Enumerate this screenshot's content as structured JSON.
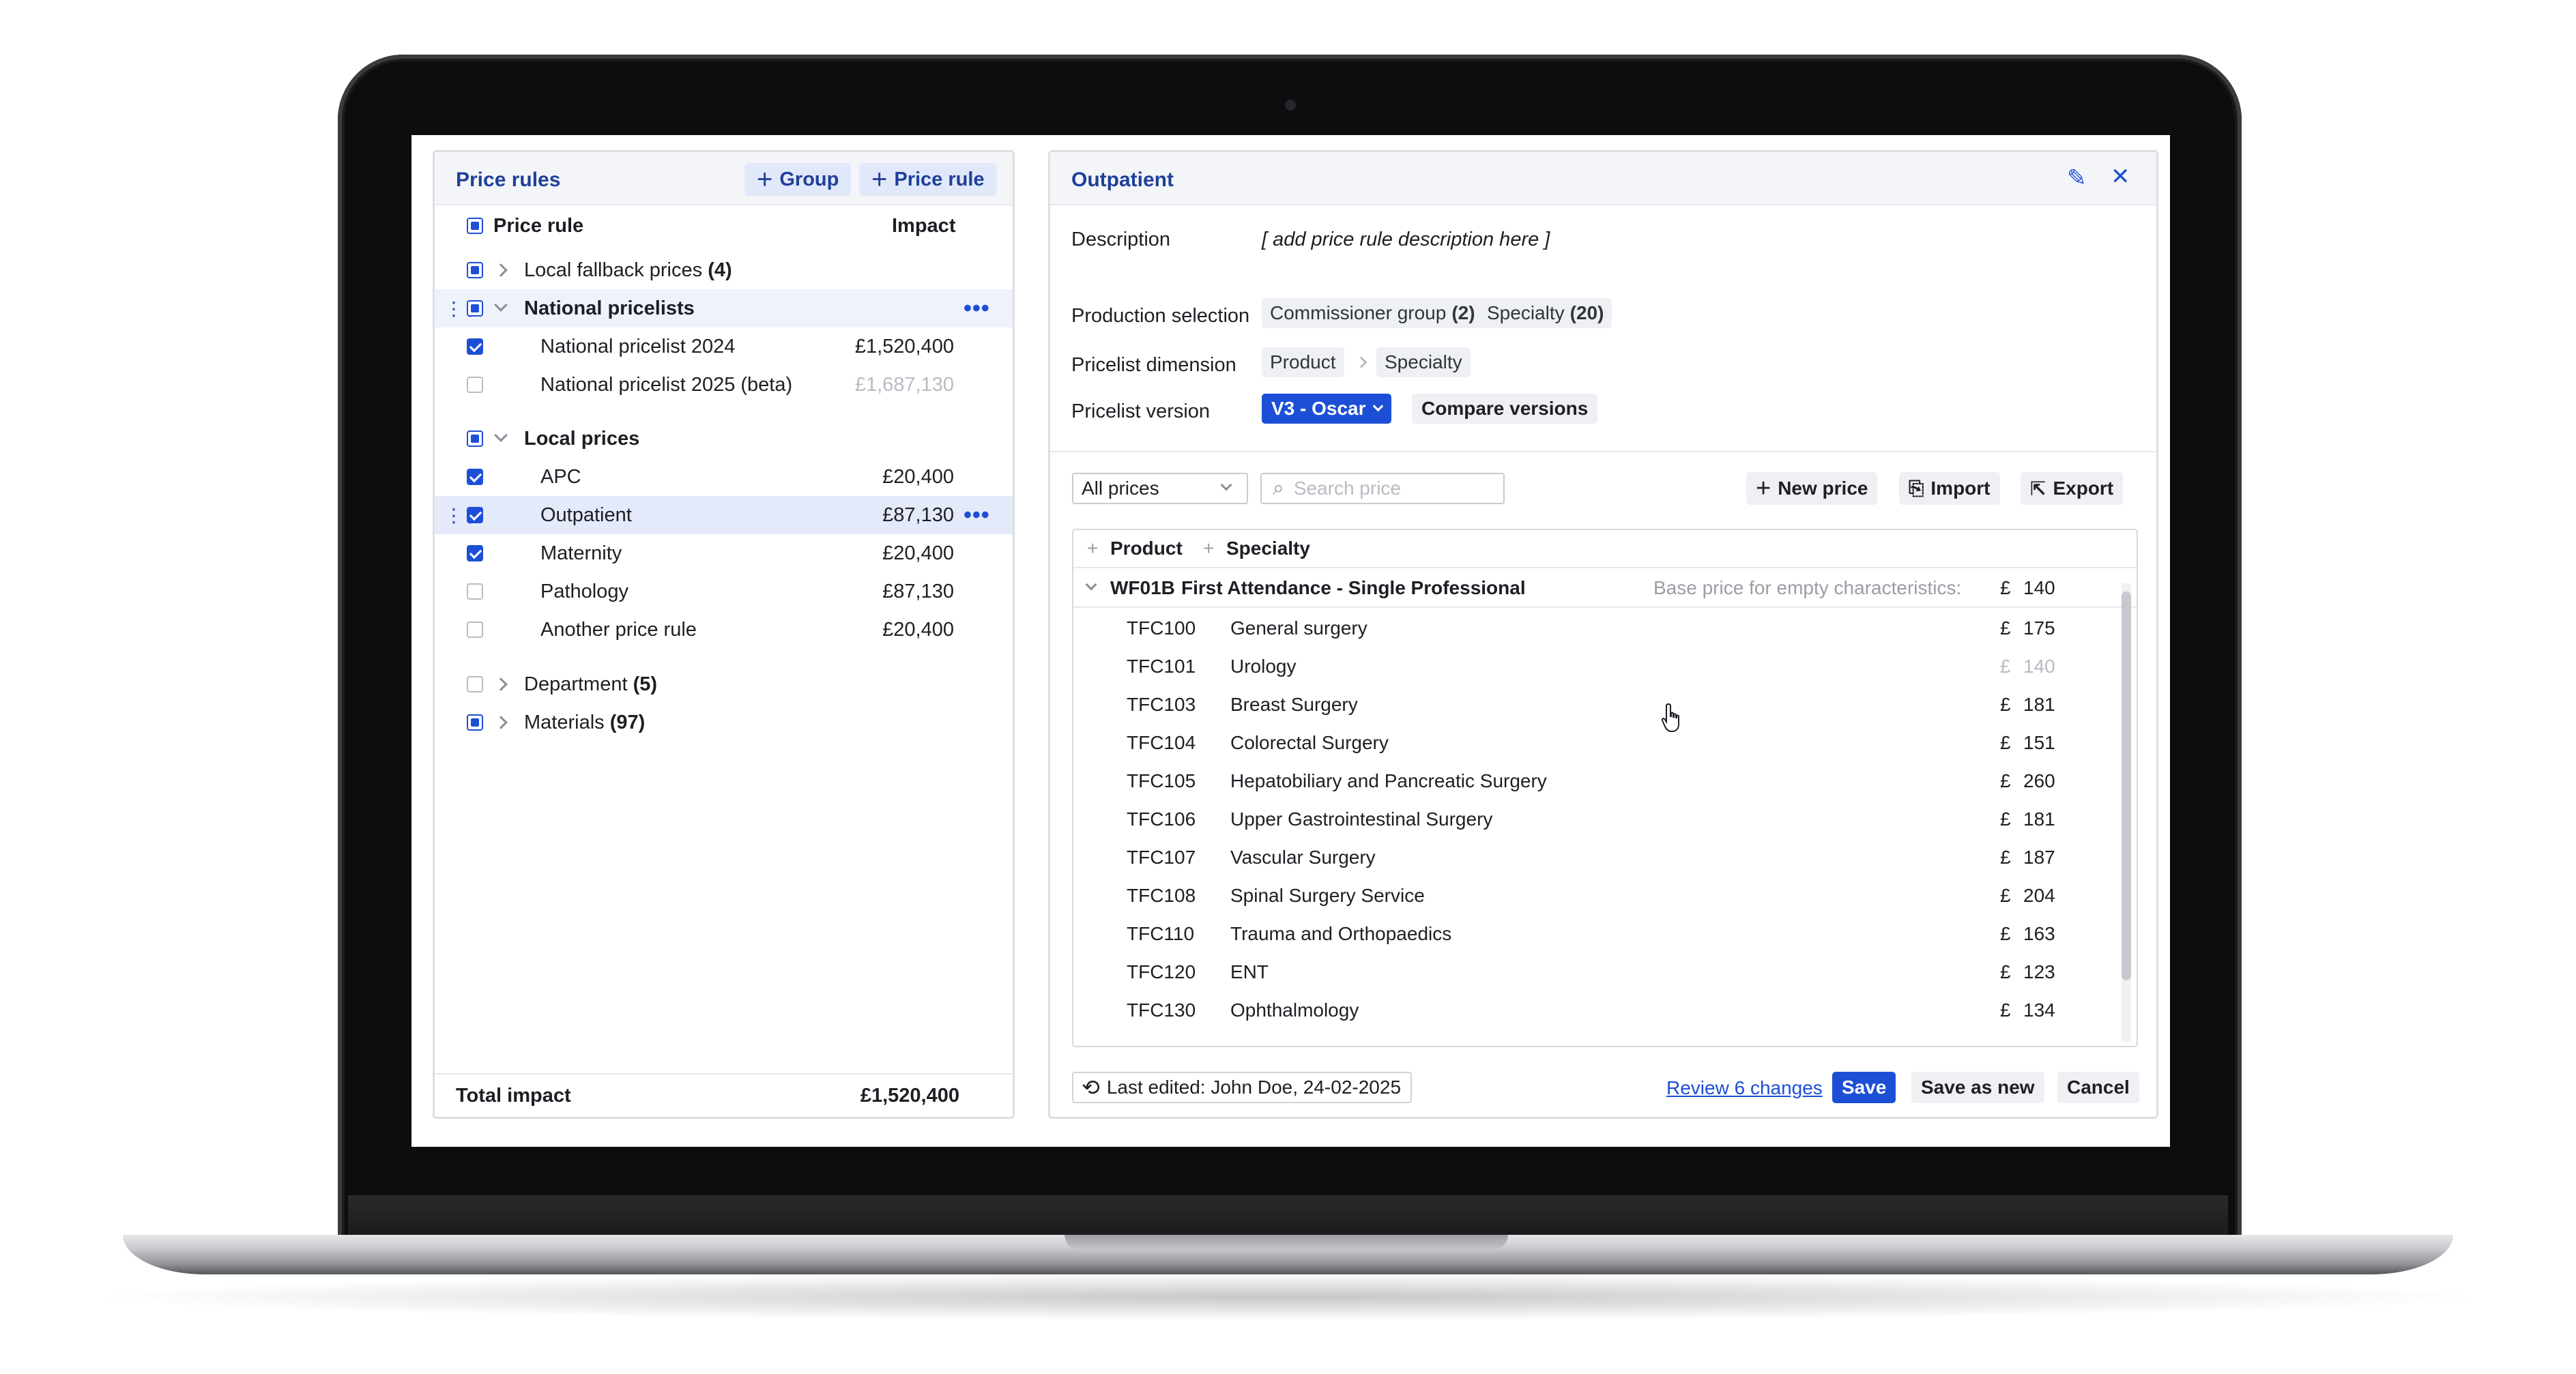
{
  "left": {
    "title": "Price rules",
    "add_group": "Group",
    "add_price_rule": "Price rule",
    "col_rule": "Price rule",
    "col_impact": "Impact",
    "groups": {
      "local_fallback": {
        "label": "Local fallback prices",
        "count": "(4)"
      },
      "national": {
        "label": "National pricelists"
      },
      "local": {
        "label": "Local prices"
      },
      "department": {
        "label": "Department",
        "count": "(5)"
      },
      "materials": {
        "label": "Materials",
        "count": "(97)"
      }
    },
    "national_items": [
      {
        "label": "National pricelist 2024",
        "amount": "£1,520,400"
      },
      {
        "label": "National pricelist 2025 (beta)",
        "amount": "£1,687,130"
      }
    ],
    "local_items": [
      {
        "label": "APC",
        "amount": "£20,400"
      },
      {
        "label": "Outpatient",
        "amount": "£87,130"
      },
      {
        "label": "Maternity",
        "amount": "£20,400"
      },
      {
        "label": "Pathology",
        "amount": "£87,130"
      },
      {
        "label": "Another price rule",
        "amount": "£20,400"
      }
    ],
    "total_label": "Total impact",
    "total_value": "£1,520,400"
  },
  "right": {
    "title": "Outpatient",
    "description_label": "Description",
    "description_value": "[ add price rule description here ]",
    "production_label": "Production selection",
    "production_tags": [
      {
        "label": "Commissioner group",
        "count": "(2)"
      },
      {
        "label": "Specialty",
        "count": "(20)"
      }
    ],
    "dimension_label": "Pricelist dimension",
    "dimension_tags": [
      "Product",
      "Specialty"
    ],
    "version_label": "Pricelist version",
    "version_value": "V3 - Oscar",
    "compare_label": "Compare versions",
    "filter_value": "All prices",
    "search_placeholder": "Search price",
    "new_price": "New price",
    "import": "Import",
    "export": "Export",
    "col_product": "Product",
    "col_specialty": "Specialty",
    "group_code": "WF01B",
    "group_name": "First Attendance - Single Professional",
    "base_price_label": "Base price for empty characteristics:",
    "currency": "£",
    "base_price": "140",
    "rows": [
      {
        "code": "TFC100",
        "name": "General surgery",
        "price": "175"
      },
      {
        "code": "TFC101",
        "name": "Urology",
        "price": "140"
      },
      {
        "code": "TFC103",
        "name": "Breast Surgery",
        "price": "181"
      },
      {
        "code": "TFC104",
        "name": "Colorectal Surgery",
        "price": "151"
      },
      {
        "code": "TFC105",
        "name": "Hepatobiliary  and  Pancreatic Surgery",
        "price": "260"
      },
      {
        "code": "TFC106",
        "name": "Upper Gastrointestinal Surgery",
        "price": "181"
      },
      {
        "code": "TFC107",
        "name": "Vascular Surgery",
        "price": "187"
      },
      {
        "code": "TFC108",
        "name": "Spinal Surgery Service",
        "price": "204"
      },
      {
        "code": "TFC110",
        "name": "Trauma  and  Orthopaedics",
        "price": "163"
      },
      {
        "code": "TFC120",
        "name": "ENT",
        "price": "123"
      },
      {
        "code": "TFC130",
        "name": "Ophthalmology",
        "price": "134"
      }
    ],
    "last_edited": "Last edited: John Doe, 24-02-2025",
    "review_link": "Review 6 changes",
    "save": "Save",
    "save_as_new": "Save as new",
    "cancel": "Cancel"
  },
  "colors": {
    "accent": "#1d4fd6",
    "title": "#1f4099",
    "highlight": "#e4eafa"
  }
}
